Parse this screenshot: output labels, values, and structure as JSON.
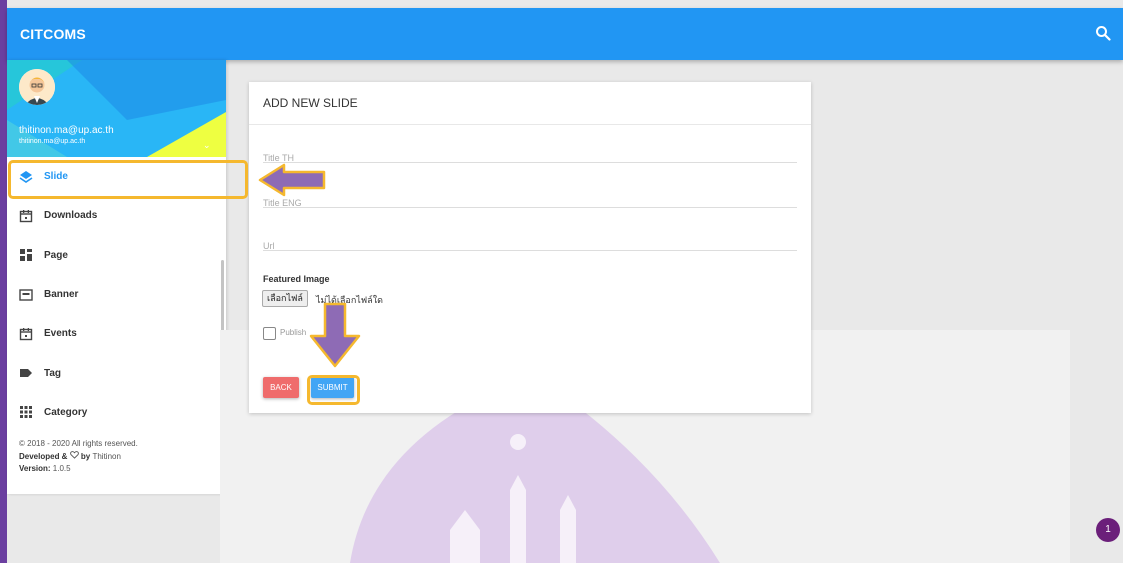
{
  "appbar": {
    "title": "CITCOMS",
    "search_icon": "search-icon"
  },
  "profile": {
    "email": "thitinon.ma@up.ac.th",
    "email_small": "thitinon.ma@up.ac.th",
    "caret": "⌄",
    "banner_colors": [
      "#26c6da",
      "#1e88e5",
      "#eeff41"
    ]
  },
  "sidebar": {
    "items": [
      {
        "label": "Slide",
        "icon": "layers-icon",
        "active": true
      },
      {
        "label": "Downloads",
        "icon": "calendar-icon"
      },
      {
        "label": "Page",
        "icon": "dashboard-icon"
      },
      {
        "label": "Banner",
        "icon": "banner-icon"
      },
      {
        "label": "Events",
        "icon": "calendar-icon"
      },
      {
        "label": "Tag",
        "icon": "tag-icon"
      },
      {
        "label": "Category",
        "icon": "apps-grid-icon"
      }
    ],
    "footer": {
      "copyright": "© 2018 - 2020 All rights reserved.",
      "developed": "Developed & ",
      "by": " by ",
      "author": "Thitinon",
      "version_label": "Version:",
      "version": " 1.0.5"
    }
  },
  "form": {
    "title": "ADD NEW SLIDE",
    "title_th_placeholder": "Title TH",
    "title_eng_placeholder": "Title ENG",
    "url_placeholder": "Url",
    "featured_image_label": "Featured Image",
    "file_button": "เลือกไฟล์",
    "file_status": "ไม่ได้เลือกไฟล์ใด",
    "publish_label": "Publish",
    "back_label": "BACK",
    "submit_label": "SUBMIT"
  },
  "badge": {
    "count": "1"
  },
  "colors": {
    "primary": "#2196f3",
    "back": "#ef6c6c",
    "submit": "#42a5f5",
    "highlight": "#f5b82e",
    "arrow": "#8e6bb5",
    "frame": "#6b3fa0"
  }
}
